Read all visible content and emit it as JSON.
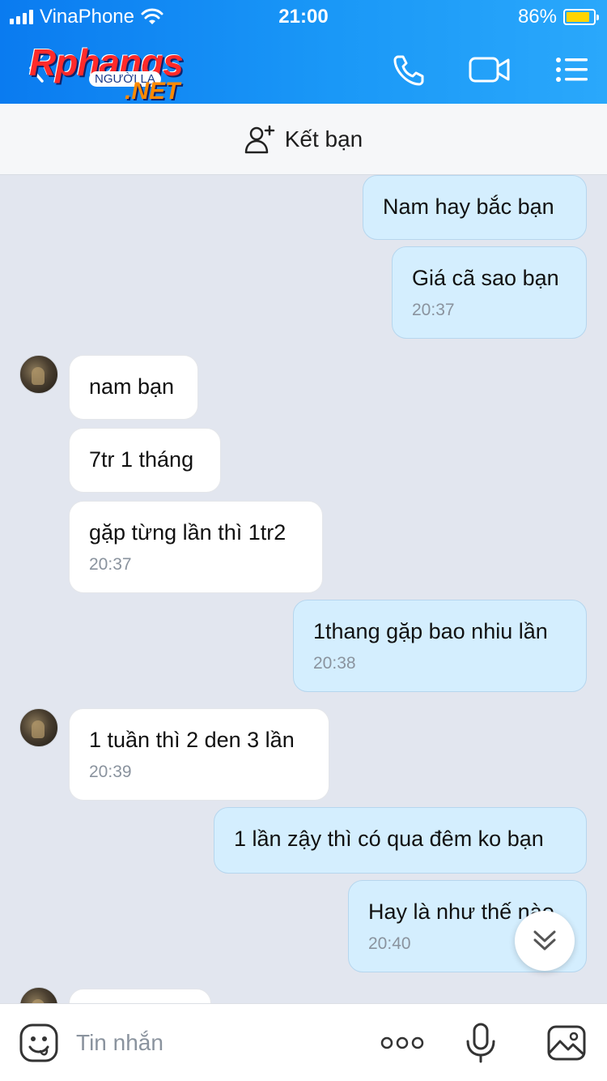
{
  "status_bar": {
    "carrier": "VinaPhone",
    "time": "21:00",
    "battery": "86%",
    "battery_level": 0.86
  },
  "nav": {
    "logo_main": "Rphangs",
    "logo_sub": "NGƯỜI LẠ",
    "logo_net": ".NET"
  },
  "friend_bar": {
    "label": "Kết bạn"
  },
  "messages": [
    {
      "dir": "out",
      "text": "Nam hay bắc bạn"
    },
    {
      "dir": "out",
      "text": "Giá cã sao bạn",
      "time": "20:37"
    },
    {
      "dir": "in",
      "text": "nam bạn"
    },
    {
      "dir": "in",
      "text": "7tr 1 tháng"
    },
    {
      "dir": "in",
      "text": "gặp từng lần thì 1tr2",
      "time": "20:37"
    },
    {
      "dir": "out",
      "text": "1thang gặp bao nhiu lần",
      "time": "20:38"
    },
    {
      "dir": "in",
      "text": "1 tuần thì 2 den 3 lần",
      "time": "20:39"
    },
    {
      "dir": "out",
      "text": "1 lần zậy thì có qua đêm ko bạn"
    },
    {
      "dir": "out",
      "text": "Hay là như thế nào",
      "time": "20:40"
    }
  ],
  "composer": {
    "placeholder": "Tin nhắn"
  },
  "colors": {
    "header_start": "#0a7bf0",
    "header_end": "#2aa8fb",
    "outgoing_bubble": "#d4eefe",
    "incoming_bubble": "#ffffff",
    "chat_background": "#e2e6ef"
  },
  "icons": {
    "back": "back-chevron-icon",
    "call": "phone-icon",
    "video": "video-camera-icon",
    "menu": "list-menu-icon",
    "add_friend": "add-person-icon",
    "emoji": "emoji-icon",
    "more": "more-dots-icon",
    "mic": "microphone-icon",
    "image": "image-icon",
    "scroll_down": "double-chevron-down-icon"
  }
}
